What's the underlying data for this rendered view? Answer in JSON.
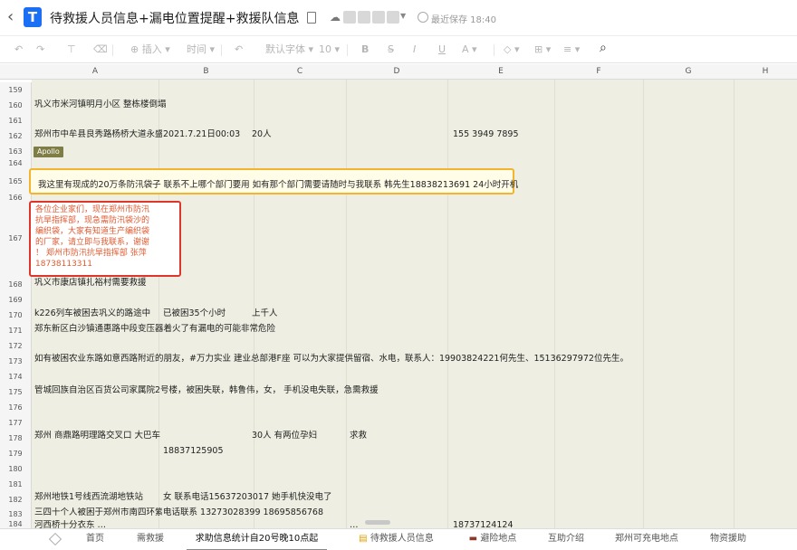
{
  "header": {
    "back_glyph": "‹",
    "logo_glyph": "T",
    "title": "待救援人员信息+漏电位置提醒+救援队信息",
    "save_status": "最近保存 18:40"
  },
  "toolbar": {
    "insert_label": "插入",
    "time_label": "时间",
    "font_label": "默认字体",
    "size_label": "10"
  },
  "columns": [
    "A",
    "B",
    "C",
    "D",
    "E",
    "F",
    "G",
    "H"
  ],
  "rows": [
    "159",
    "160",
    "161",
    "162",
    "163",
    "164",
    "165",
    "166",
    "167",
    "168",
    "169",
    "170",
    "171",
    "172",
    "173",
    "174",
    "175",
    "176",
    "177",
    "178",
    "179",
    "180",
    "181",
    "182",
    "183",
    "184"
  ],
  "cells": {
    "r160": "巩义市米河镇明月小区 整栋楼倒塌",
    "r162_a": "郑州市中牟县良秀路杨桥大道永盛",
    "r162_b": "2021.7.21日00:03",
    "r162_c": "20人",
    "r162_e": "155 3949 7895",
    "apollo": "Apollo",
    "r165": "我这里有现成的20万条防汛袋子 联系不上哪个部门要用 如有那个部门需要请随时与我联系 韩先生18838213691 24小时开机",
    "r167": [
      "各位企业家们，现在郑州市防汛",
      "抗旱指挥部，现急需防汛袋沙的",
      "编织袋，大家有知道生产编织袋",
      "的厂家，请立即与我联系，谢谢",
      "！ 郑州市防汛抗旱指挥部 张萍",
      "18738113311"
    ],
    "r168": "巩义市康店镇扎裕村需要救援",
    "r170_a": "k226列车被困去巩义的路途中",
    "r170_b": "已被困35个小时",
    "r170_c": "上千人",
    "r171": "郑东新区白沙镇通惠路中段变压器着火了有漏电的可能非常危险",
    "r173": "如有被困农业东路如意西路附近的朋友，#万力实业 建业总部港F座 可以为大家提供留宿、水电，联系人：19903824221何先生、15136297972位先生。",
    "r175": "管城回族自治区百货公司家属院2号楼，被困失联，韩鲁伟，女，  手机没电失联，急需救援",
    "r178_a": "郑州 商鼎路明理路交叉口 大巴车",
    "r178_c": "30人 有两位孕妇",
    "r178_d": "求救",
    "r179_b": "18837125905",
    "r182_a": "郑州地铁1号线西流湖地铁站",
    "r182_b": "女  联系电话15637203017   她手机快没电了",
    "r183_a": "三四十个人被困于郑州市南四环紫",
    "r183_b": "电话联系 13273028399   18695856768",
    "r184_a": "河西桥十分衣东   …",
    "r184_d": "…",
    "r184_e": "18737124124"
  },
  "sheet_tabs": [
    "首页",
    "需救援",
    "求助信息统计自20号晚10点起",
    "待救援人员信息",
    "避险地点",
    "互助介绍",
    "郑州可充电地点",
    "物资援助"
  ],
  "active_tab_index": 2,
  "colors": {
    "logo": "#1a6ff5",
    "highlight_yellow": "#f3b52e",
    "highlight_red": "#e0352a",
    "red_text": "#e05a30",
    "cell_bg": "#eeeee2"
  }
}
